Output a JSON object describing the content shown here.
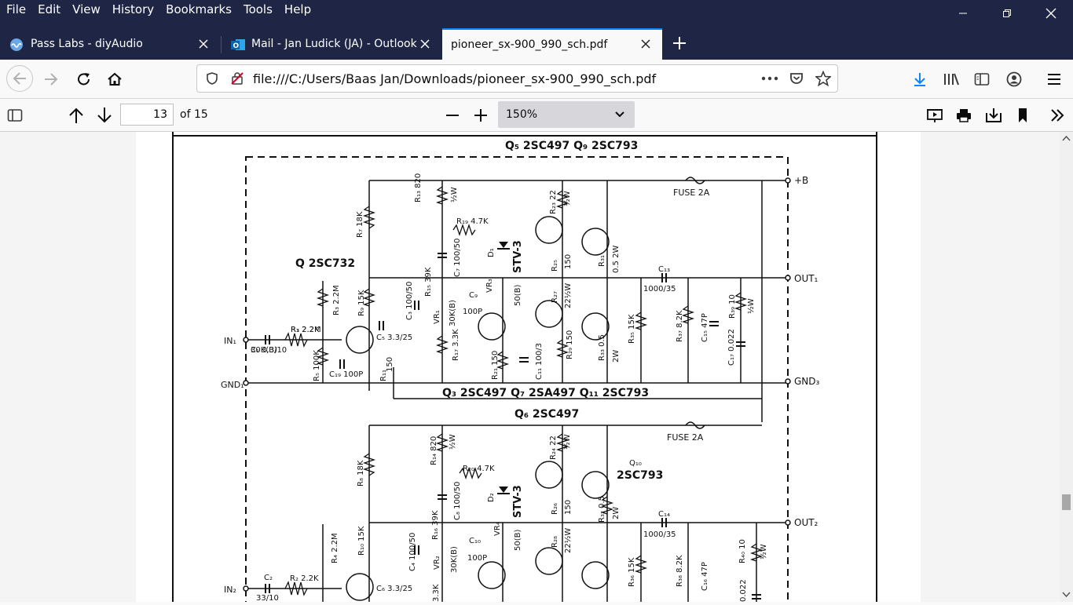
{
  "menu": [
    "File",
    "Edit",
    "View",
    "History",
    "Bookmarks",
    "Tools",
    "Help"
  ],
  "tabs": [
    {
      "title": "Pass Labs - diyAudio",
      "icon": "diyaudio-icon",
      "active": false
    },
    {
      "title": "Mail - Jan Ludick (JA) - Outlook",
      "icon": "outlook-icon",
      "active": false
    },
    {
      "title": "pioneer_sx-900_990_sch.pdf",
      "icon": "",
      "active": true
    }
  ],
  "url": "file:///C:/Users/Baas Jan/Downloads/pioneer_sx-900_990_sch.pdf",
  "pdf": {
    "page_value": "13",
    "page_of": "of 15",
    "zoom": "150%"
  },
  "schematic": {
    "top_labels": {
      "q5_q9": "Q₅ 2SC497  Q₉ 2SC793",
      "q": "Q  2SC732",
      "q3q7q11": "Q₃ 2SC497   Q₇ 2SA497  Q₁₁ 2SC793",
      "q6": "Q₆ 2SC497",
      "q10": "Q₁₀",
      "q10type": "2SC793"
    },
    "rails": {
      "plus_b": "+B",
      "out1": "OUT₁",
      "gnd3": "GND₃",
      "out2": "OUT₂",
      "in1": "IN₁",
      "gnd1": "GND₁",
      "in2": "IN₂"
    },
    "fuses": [
      "FUSE 2A",
      "FUSE 2A"
    ],
    "components_upper": [
      "R₁₃ 820",
      "½W",
      "R₇ 18K",
      "R₁₉ 4.7K",
      "R₂₃ 22",
      "½W",
      "D₁",
      "STV-3",
      "C₇ 100/50",
      "R₂₅",
      "150",
      "R₃₁",
      "0.5 2W",
      "C₁₃",
      "1000/35",
      "R₁₅ 39K",
      "VR₃",
      "50(B)",
      "R₂₇",
      "22½W",
      "C₉",
      "100P",
      "VR₁",
      "30K(B)",
      "R₃ 2.2M",
      "R₉ 15K",
      "C₃ 100/50",
      "C₁ 3.3/10",
      "R₁ 2.2K",
      "R₅ 100K",
      "C₁₉ 100P",
      "R₁₁",
      "150",
      "C₅ 3.3/25",
      "R₁₇ 3.3K",
      "R₂₁ 150",
      "C₁₁ 100/3",
      "R₂₉ 150",
      "R₃₃ 0.5",
      "2W",
      "R₃₅ 15K",
      "R₃₇ 8.2K",
      "C₁₅ 47P",
      "C₁₇ 0.022",
      "R₃₉ 10",
      "½W"
    ],
    "components_lower": [
      "R₁₄ 820",
      "½W",
      "R₈ 18K",
      "R₂₀ 4.7K",
      "R₂₄ 22",
      "½W",
      "D₂",
      "STV-3",
      "C₈ 100/50",
      "R₂₆",
      "150",
      "R₃₂ 0.5",
      "2W",
      "C₁₄",
      "1000/35",
      "R₁₆ 39K",
      "VR₄",
      "50(B)",
      "R₂₈",
      "22½W",
      "C₁₀",
      "100P",
      "VR₂",
      "30K(B)",
      "R₄ 2.2M",
      "R₁₀ 15K",
      "C₄ 100/50",
      "C₂",
      "33/10",
      "R₂ 2.2K",
      "C₆ 3.3/25",
      "3.3K",
      "R₃₆ 15K",
      "R₃₈ 8.2K",
      "C₁₆ 47P",
      "R₄₀ 10",
      "½W",
      "0.022"
    ]
  }
}
